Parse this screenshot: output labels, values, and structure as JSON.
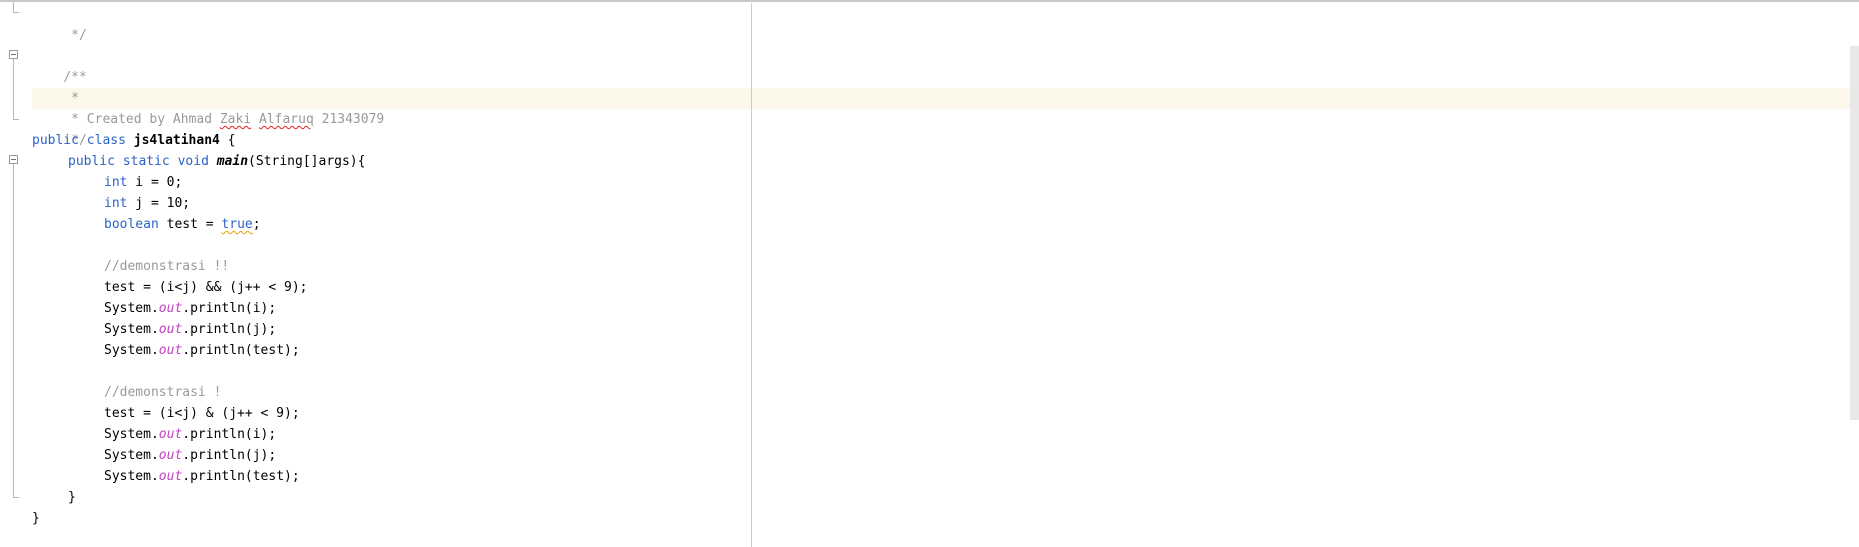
{
  "editor": {
    "lines": {
      "l01": " */",
      "l03": "/**",
      "l04": " *",
      "l05": {
        "pre": " * Created by Ahmad ",
        "w1": "Zaki",
        "sp": " ",
        "w2": "Alfaruq",
        "post": " 21343079"
      },
      "l06": " */",
      "l07": {
        "kw1": "public",
        "sp1": " ",
        "kw2": "class",
        "sp2": " ",
        "name": "js4latihan4",
        "rest": " {"
      },
      "l08": {
        "kw1": "public",
        "sp1": " ",
        "kw2": "static",
        "sp2": " ",
        "kw3": "void",
        "sp3": " ",
        "name": "main",
        "rest": "(String[]args){"
      },
      "l09": {
        "kw": "int",
        "rest": " i = 0;"
      },
      "l10": {
        "kw": "int",
        "rest": " j = 10;"
      },
      "l11": {
        "kw": "boolean",
        "mid": " test = ",
        "val": "true",
        "end": ";"
      },
      "l13": "//demonstrasi !!",
      "l14": "test = (i<j) && (j++ < 9);",
      "l15": {
        "pre": "System.",
        "field": "out",
        "post": ".println(i);"
      },
      "l16": {
        "pre": "System.",
        "field": "out",
        "post": ".println(j);"
      },
      "l17": {
        "pre": "System.",
        "field": "out",
        "post": ".println(test);"
      },
      "l19": "//demonstrasi !",
      "l20": "test = (i<j) & (j++ < 9);",
      "l21": {
        "pre": "System.",
        "field": "out",
        "post": ".println(i);"
      },
      "l22": {
        "pre": "System.",
        "field": "out",
        "post": ".println(j);"
      },
      "l23": {
        "pre": "System.",
        "field": "out",
        "post": ".println(test);"
      },
      "l24": "}",
      "l25": "}"
    }
  }
}
